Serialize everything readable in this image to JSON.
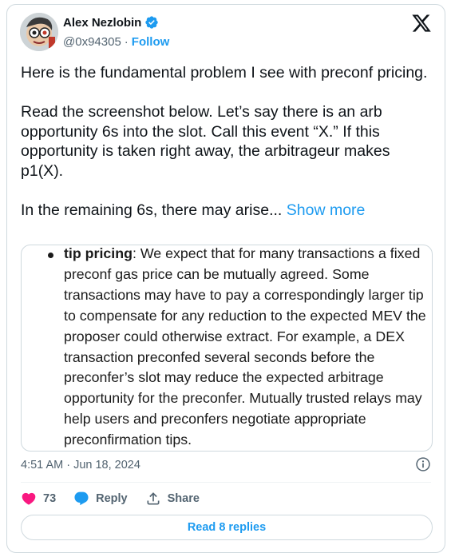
{
  "author": {
    "name": "Alex Nezlobin",
    "handle": "@0x94305",
    "separator": "·",
    "follow_label": "Follow"
  },
  "tweet": {
    "paragraphs": [
      "Here is the fundamental problem I see with preconf pricing.",
      "Read the screenshot below. Let’s say there is an arb opportunity 6s into the slot. Call this event “X.” If this opportunity is taken right away, the arbitrageur makes p1(X)."
    ],
    "last_line": "In the remaining 6s, there may arise...",
    "show_more_label": "Show more"
  },
  "media": {
    "bold_term": "tip pricing",
    "body": ": We expect that for many transactions a fixed preconf gas price can be mutually agreed. Some transactions may have to pay a correspondingly larger tip to compensate for any reduction to the expected MEV the proposer could otherwise extract. For example, a DEX transaction preconfed several seconds before the preconfer’s slot may reduce the expected arbitrage opportunity for the preconfer. Mutually trusted relays may help users and preconfers negotiate appropriate preconfirmation tips."
  },
  "meta": {
    "timestamp": "4:51 AM · Jun 18, 2024"
  },
  "actions": {
    "likes": "73",
    "reply_label": "Reply",
    "share_label": "Share",
    "read_replies_label": "Read 8 replies"
  },
  "colors": {
    "accent": "#1d9bf0",
    "like": "#f91880",
    "text": "#0f1419",
    "muted": "#536471",
    "border": "#cfd9de"
  },
  "icons": [
    "verified-badge-icon",
    "x-logo-icon",
    "info-icon",
    "heart-icon",
    "reply-bubble-icon",
    "share-icon"
  ]
}
